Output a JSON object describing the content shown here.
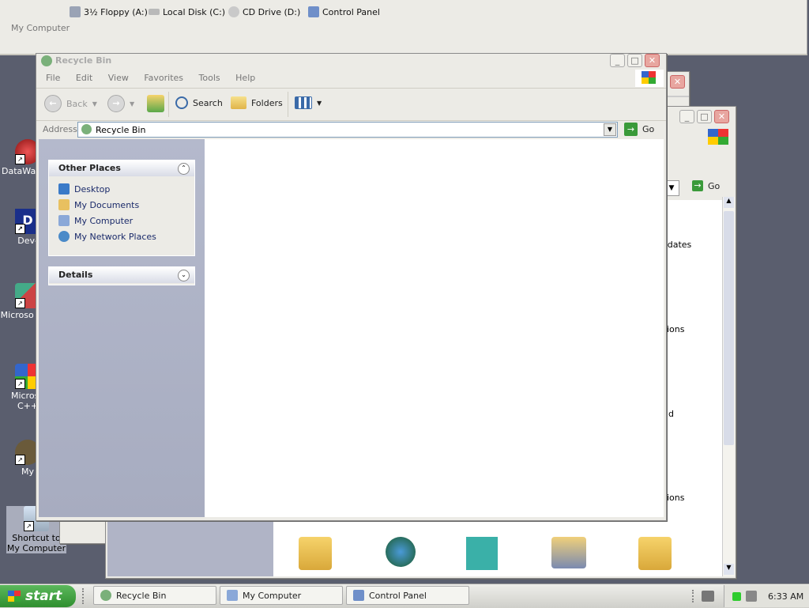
{
  "top_strip": {
    "drives": [
      {
        "label": "3½ Floppy (A:)",
        "icon": "floppy-icon"
      },
      {
        "label": "Local Disk (C:)",
        "icon": "hard-disk-icon"
      },
      {
        "label": "CD Drive (D:)",
        "icon": "cd-drive-icon"
      },
      {
        "label": "Control Panel",
        "icon": "control-panel-icon"
      }
    ],
    "title": "My Computer"
  },
  "desktop_icons": [
    {
      "label": "DataWa",
      "icon": "datawave-icon"
    },
    {
      "label": "Dev-",
      "icon": "dev-cpp-icon"
    },
    {
      "label": "Microso Basi",
      "icon": "visual-basic-icon"
    },
    {
      "label": "Microso C++",
      "icon": "visual-cpp-icon"
    },
    {
      "label": "My",
      "icon": "my-shortcut-icon"
    },
    {
      "label": "Shortcut to My Computer",
      "icon": "my-computer-shortcut-icon"
    }
  ],
  "back_window": {
    "go_label": "Go",
    "partial_labels": [
      "odates",
      "ions",
      "d",
      "ions"
    ]
  },
  "recycle_window": {
    "title": "Recycle Bin",
    "menu": [
      "File",
      "Edit",
      "View",
      "Favorites",
      "Tools",
      "Help"
    ],
    "toolbar": {
      "back": "Back",
      "search": "Search",
      "folders": "Folders"
    },
    "address_label": "Address",
    "address_value": "Recycle Bin",
    "go_label": "Go",
    "other_places": {
      "title": "Other Places",
      "items": [
        "Desktop",
        "My Documents",
        "My Computer",
        "My Network Places"
      ]
    },
    "details_title": "Details"
  },
  "taskbar": {
    "start_label": "start",
    "tasks": [
      "Recycle Bin",
      "My Computer",
      "Control Panel"
    ],
    "clock": "6:33 AM"
  }
}
